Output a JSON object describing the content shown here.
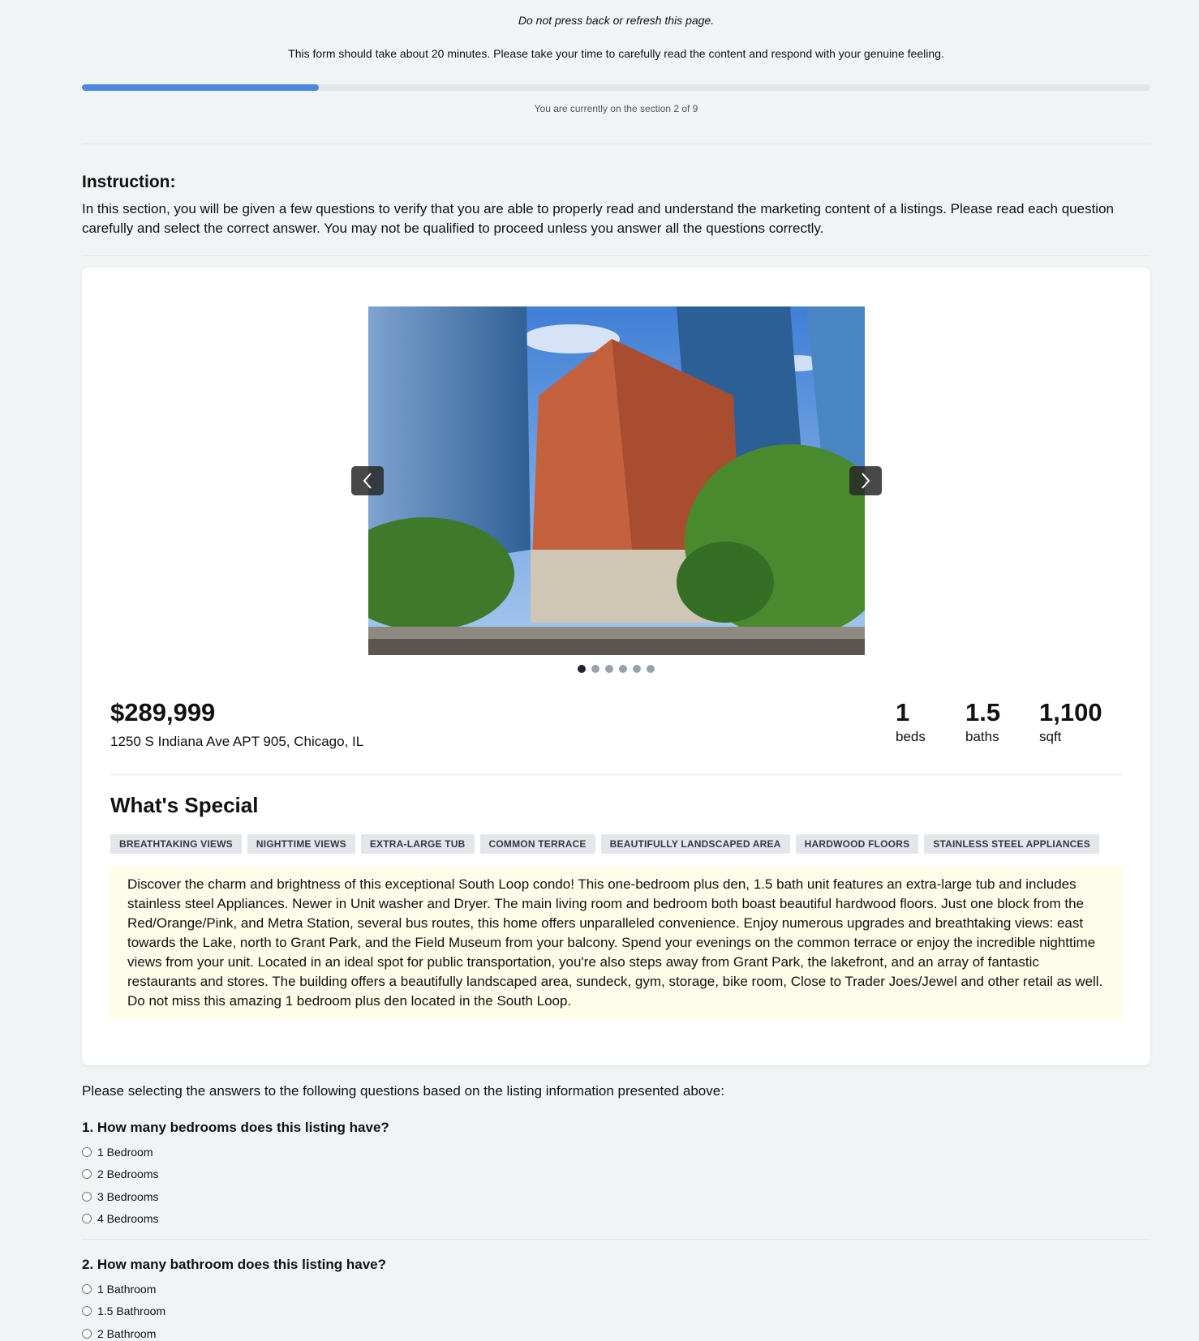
{
  "header": {
    "warning": "Do not press back or refresh this page.",
    "duration_note": "This form should take about 20 minutes. Please take your time to carefully read the content and respond with your genuine feeling.",
    "progress_fraction": 0.222,
    "progress_text": "You are currently on the section 2 of 9"
  },
  "instruction": {
    "title": "Instruction:",
    "body": "In this section, you will be given a few questions to verify that you are able to properly read and understand the marketing content of a listings. Please read each question carefully and select the correct answer. You may not be qualified to proceed unless you answer all the questions correctly."
  },
  "listing": {
    "price": "$289,999",
    "address": "1250 S Indiana Ave APT 905, Chicago, IL",
    "stats": [
      {
        "value": "1",
        "label": "beds"
      },
      {
        "value": "1.5",
        "label": "baths"
      },
      {
        "value": "1,100",
        "label": "sqft"
      }
    ],
    "carousel": {
      "total": 6,
      "active": 0
    },
    "special_title": "What's Special",
    "tags": [
      "BREATHTAKING VIEWS",
      "NIGHTTIME VIEWS",
      "EXTRA-LARGE TUB",
      "COMMON TERRACE",
      "BEAUTIFULLY LANDSCAPED AREA",
      "HARDWOOD FLOORS",
      "STAINLESS STEEL APPLIANCES"
    ],
    "description": "Discover the charm and brightness of this exceptional South Loop condo! This one-bedroom plus den, 1.5 bath unit features an extra-large tub and includes stainless steel Appliances. Newer in Unit washer and Dryer. The main living room and bedroom both boast beautiful hardwood floors. Just one block from the Red/Orange/Pink, and Metra Station, several bus routes, this home offers unparalleled convenience. Enjoy numerous upgrades and breathtaking views: east towards the Lake, north to Grant Park, and the Field Museum from your balcony. Spend your evenings on the common terrace or enjoy the incredible nighttime views from your unit. Located in an ideal spot for public transportation, you're also steps away from Grant Park, the lakefront, and an array of fantastic restaurants and stores. The building offers a beautifully landscaped area, sundeck, gym, storage, bike room, Close to Trader Joes/Jewel and other retail as well. Do not miss this amazing 1 bedroom plus den located in the South Loop."
  },
  "questions": {
    "intro": "Please selecting the answers to the following questions based on the listing information presented above:",
    "q1": {
      "title": "1. How many bedrooms does this listing have?",
      "options": [
        "1 Bedroom",
        "2 Bedrooms",
        "3 Bedrooms",
        "4 Bedrooms"
      ]
    },
    "q2": {
      "title": "2. How many bathroom does this listing have?",
      "options": [
        "1 Bathroom",
        "1.5 Bathroom",
        "2 Bathroom"
      ]
    }
  },
  "colors": {
    "page_bg": "#f1f4f5",
    "progress_fill": "#4b88e0",
    "description_bg": "#fefde9"
  },
  "icons": [
    "chevron-left-icon",
    "chevron-right-icon"
  ]
}
